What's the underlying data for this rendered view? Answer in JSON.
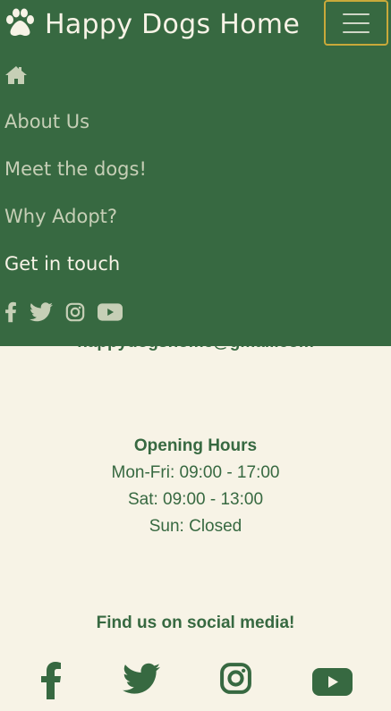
{
  "brand": {
    "name": "Happy Dogs Home"
  },
  "nav": {
    "links": [
      "About Us",
      "Meet the dogs!",
      "Why Adopt?",
      "Get in touch"
    ],
    "active_index": 3
  },
  "contact": {
    "email": "happydogshome@gmail.com"
  },
  "hours": {
    "heading": "Opening Hours",
    "lines": [
      "Mon-Fri: 09:00 - 17:00",
      "Sat: 09:00 - 13:00",
      "Sun: Closed"
    ]
  },
  "social": {
    "heading": "Find us on social media!"
  },
  "colors": {
    "primary_green": "#376941",
    "cream": "#f7f3e6",
    "muted_link": "#c6cfb6",
    "toggler_border": "#c9a93a"
  },
  "icons": [
    "paw-icon",
    "hamburger-icon",
    "home-icon",
    "facebook-icon",
    "twitter-icon",
    "instagram-icon",
    "youtube-icon"
  ]
}
